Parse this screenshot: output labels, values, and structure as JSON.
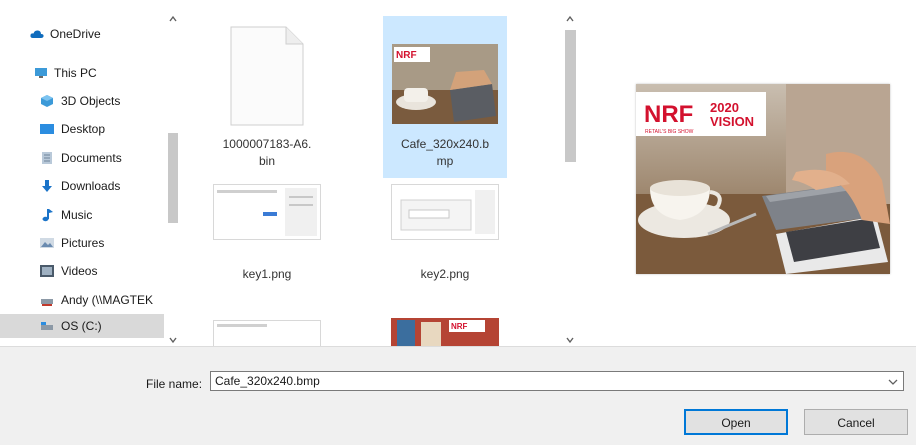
{
  "colors": {
    "selection": "#cce8ff",
    "accent": "#0078d7",
    "nrf_red": "#d3112e"
  },
  "nav": {
    "items": [
      {
        "label": "OneDrive",
        "icon": "cloud-icon"
      },
      {
        "label": "This PC",
        "icon": "computer-icon"
      },
      {
        "label": "3D Objects",
        "icon": "cube-icon"
      },
      {
        "label": "Desktop",
        "icon": "desktop-icon"
      },
      {
        "label": "Documents",
        "icon": "document-icon"
      },
      {
        "label": "Downloads",
        "icon": "download-icon"
      },
      {
        "label": "Music",
        "icon": "music-icon"
      },
      {
        "label": "Pictures",
        "icon": "pictures-icon"
      },
      {
        "label": "Videos",
        "icon": "video-icon"
      },
      {
        "label": "Andy (\\\\MAGTEK",
        "icon": "network-drive-icon"
      },
      {
        "label": "OS (C:)",
        "icon": "drive-icon",
        "selected": true
      }
    ]
  },
  "files": {
    "items": [
      {
        "name": "1000007183-A6.bin",
        "line1": "1000007183-A6.",
        "line2": "bin",
        "type": "bin"
      },
      {
        "name": "Cafe_320x240.bmp",
        "line1": "Cafe_320x240.b",
        "line2": "mp",
        "type": "image",
        "selected": true
      },
      {
        "name": "key1.png",
        "line1": "key1.png",
        "line2": "",
        "type": "screenshot"
      },
      {
        "name": "key2.png",
        "line1": "key2.png",
        "line2": "",
        "type": "screenshot"
      }
    ]
  },
  "preview": {
    "brand": "NRF",
    "year": "2020",
    "vision": "VISION",
    "tagline": "RETAIL'S BIG SHOW"
  },
  "bottom": {
    "file_name_label": "File name:",
    "file_name_value": "Cafe_320x240.bmp",
    "open_label": "Open",
    "cancel_label": "Cancel"
  }
}
